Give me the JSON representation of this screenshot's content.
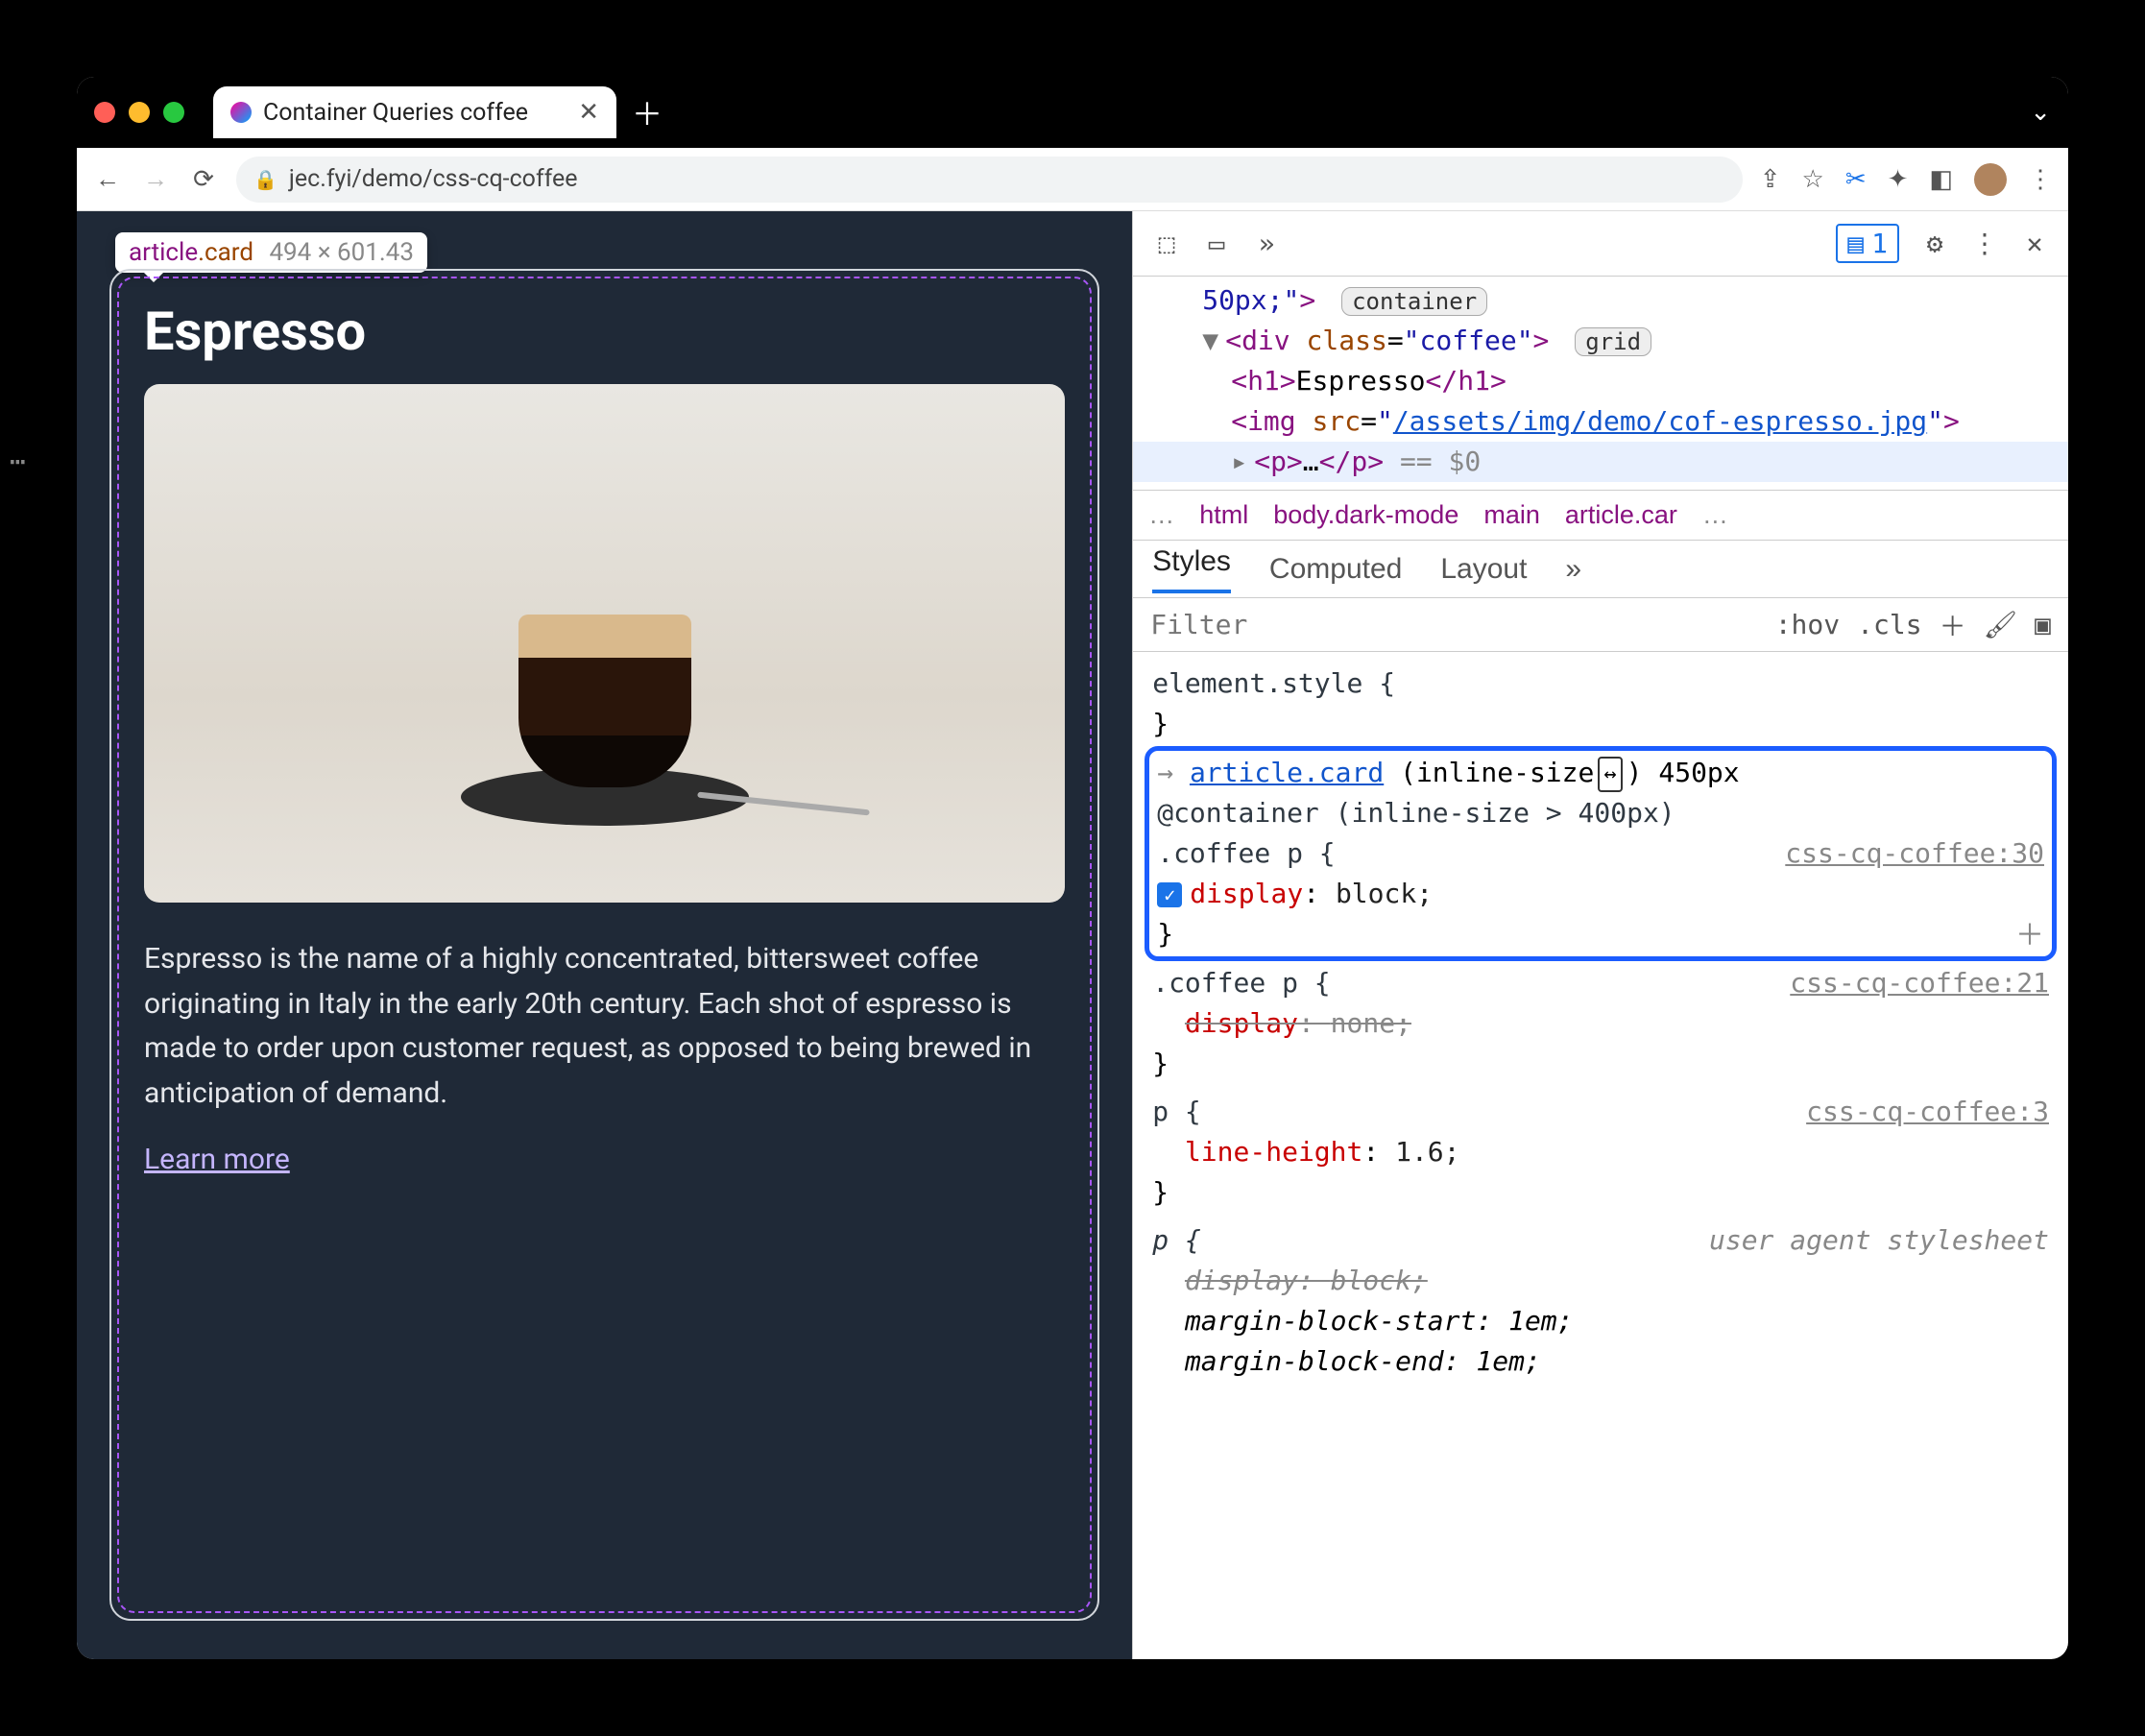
{
  "browser": {
    "tab_title": "Container Queries coffee",
    "url": "jec.fyi/demo/css-cq-coffee"
  },
  "inspect_tooltip": {
    "selector_tag": "article",
    "selector_class": ".card",
    "dimensions": "494 × 601.43"
  },
  "page": {
    "heading": "Espresso",
    "paragraph": "Espresso is the name of a highly concentrated, bittersweet coffee originating in Italy in the early 20th century. Each shot of espresso is made to order upon customer request, as opposed to being brewed in anticipation of demand.",
    "learn_more": "Learn more"
  },
  "devtools": {
    "top": {
      "messages": "1"
    },
    "elements": {
      "line0_style": "50px;\"",
      "line0_badge": "container",
      "div_class": "coffee",
      "div_badge": "grid",
      "h1_text": "Espresso",
      "img_src": "/assets/img/demo/cof-espresso.jpg",
      "p_eq": "== $0"
    },
    "breadcrumbs": [
      "…",
      "html",
      "body.dark-mode",
      "main",
      "article.car",
      "…"
    ],
    "tabs": [
      "Styles",
      "Computed",
      "Layout"
    ],
    "filter_placeholder": "Filter",
    "filter_right": {
      "hov": ":hov",
      "cls": ".cls"
    },
    "rules": {
      "element_style": "element.style {",
      "cq_selector": "article.card",
      "cq_size_label": "(inline-size",
      "cq_size_value": "450px",
      "cq_at": "@container (inline-size > 400px)",
      "r1_sel": ".coffee p {",
      "r1_src": "css-cq-coffee:30",
      "r1_prop": "display",
      "r1_val": "block;",
      "r2_sel": ".coffee p {",
      "r2_src": "css-cq-coffee:21",
      "r2_prop": "display",
      "r2_val": "none;",
      "r3_sel": "p {",
      "r3_src": "css-cq-coffee:3",
      "r3_prop": "line-height",
      "r3_val": "1.6;",
      "r4_sel": "p {",
      "r4_ua": "user agent stylesheet",
      "r4_p1": "display",
      "r4_v1": "block;",
      "r4_p2": "margin-block-start",
      "r4_v2": "1em;",
      "r4_p3": "margin-block-end",
      "r4_v3": "1em;"
    }
  }
}
